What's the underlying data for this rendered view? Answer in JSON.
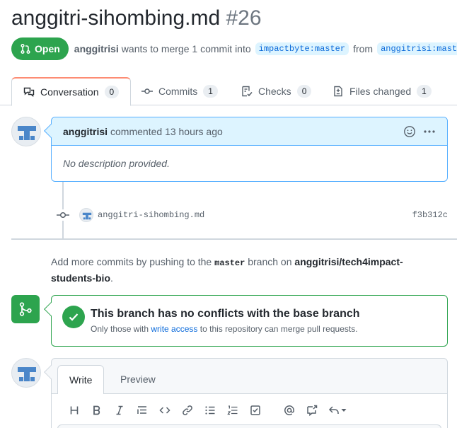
{
  "pr": {
    "title": "anggitri-sihombing.md",
    "number": "#26",
    "state": "Open",
    "author": "anggitrisi",
    "summary": "wants to merge 1 commit into",
    "base_branch": "impactbyte:master",
    "from_word": "from",
    "head_branch": "anggitrisi:master"
  },
  "tabs": [
    {
      "label": "Conversation",
      "count": "0",
      "icon": "comment-discussion-icon"
    },
    {
      "label": "Commits",
      "count": "1",
      "icon": "git-commit-icon"
    },
    {
      "label": "Checks",
      "count": "0",
      "icon": "checklist-icon"
    },
    {
      "label": "Files changed",
      "count": "1",
      "icon": "file-diff-icon"
    }
  ],
  "comment": {
    "author": "anggitrisi",
    "action": "commented",
    "time": "13 hours ago",
    "body": "No description provided."
  },
  "commit": {
    "message": "anggitri-sihombing.md",
    "sha": "f3b312c"
  },
  "hint": {
    "prefix": "Add more commits by pushing to the",
    "branch": "master",
    "middle": "branch on",
    "repo": "anggitrisi/tech4impact-students-bio",
    "suffix": "."
  },
  "merge": {
    "title": "This branch has no conflicts with the base branch",
    "sub_prefix": "Only those with",
    "sub_link": "write access",
    "sub_suffix": "to this repository can merge pull requests."
  },
  "editor": {
    "write_tab": "Write",
    "preview_tab": "Preview"
  },
  "colors": {
    "open_green": "#2da44e",
    "link_blue": "#0969da",
    "comment_header_bg": "#ddf4ff"
  }
}
